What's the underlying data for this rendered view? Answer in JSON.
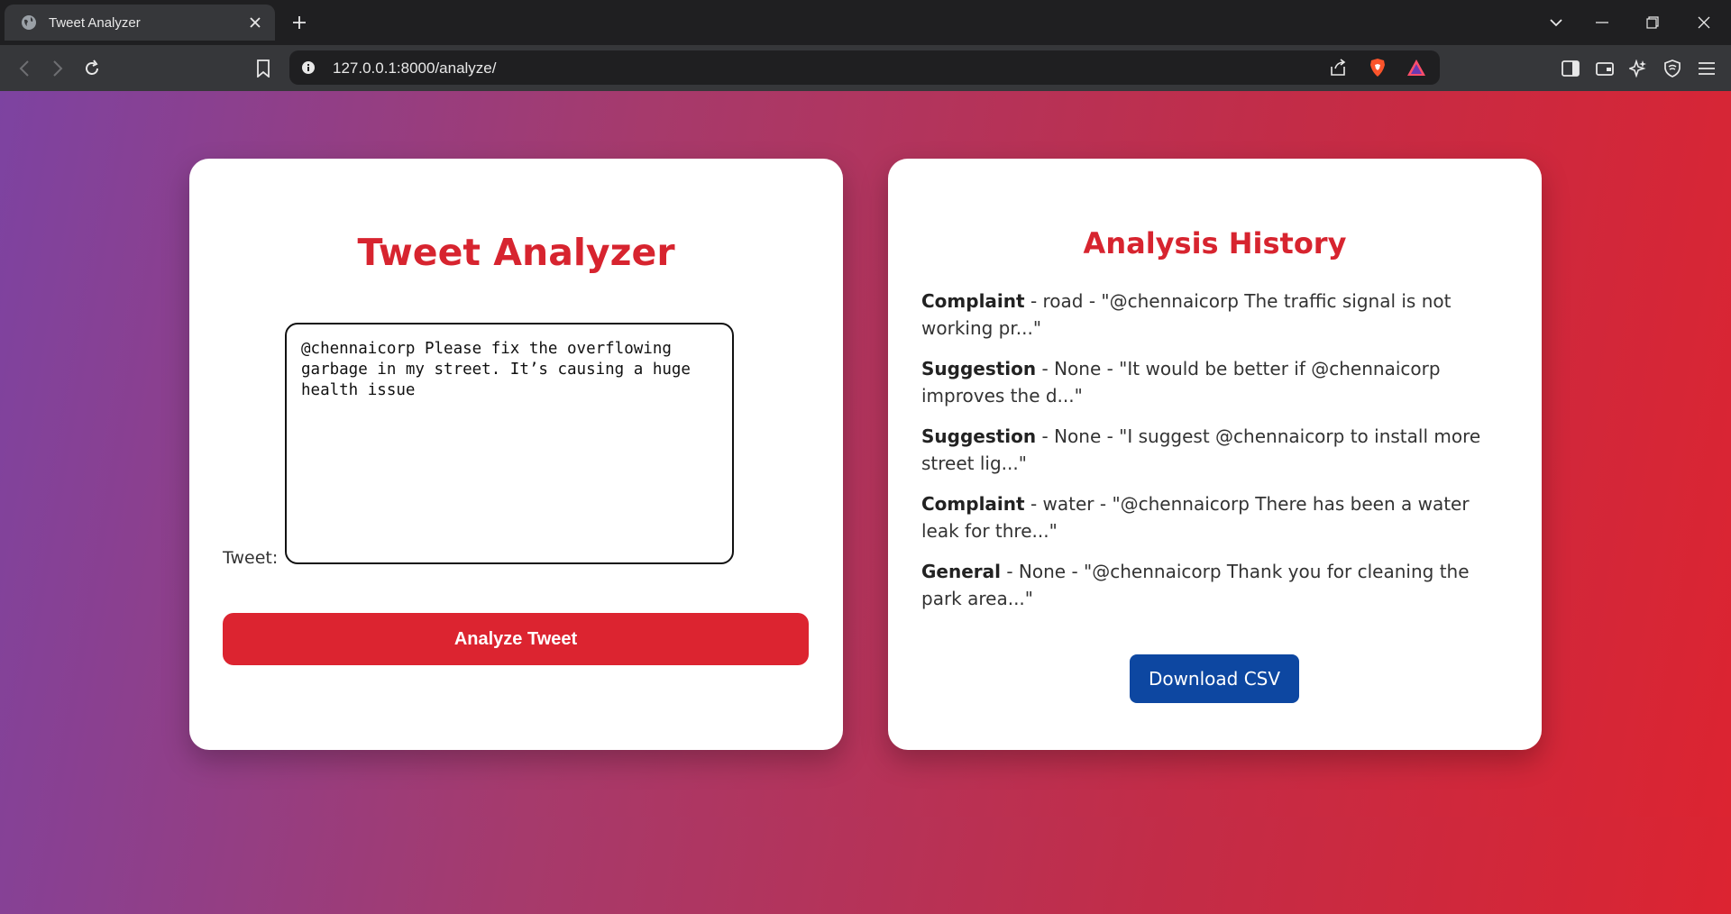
{
  "browser": {
    "tab_title": "Tweet Analyzer",
    "url": "127.0.0.1:8000/analyze/"
  },
  "analyzer": {
    "title": "Tweet Analyzer",
    "tweet_label": "Tweet:",
    "tweet_value": "@chennaicorp Please fix the overflowing garbage in my street. It’s causing a huge health issue",
    "analyze_button": "Analyze Tweet"
  },
  "history": {
    "title": "Analysis History",
    "items": [
      {
        "category": "Complaint",
        "rest": " - road - \"@chennaicorp The traffic signal is not working pr...\""
      },
      {
        "category": "Suggestion",
        "rest": " - None - \"It would be better if @chennaicorp improves the d...\""
      },
      {
        "category": "Suggestion",
        "rest": " - None - \"I suggest @chennaicorp to install more street lig...\""
      },
      {
        "category": "Complaint",
        "rest": " - water - \"@chennaicorp There has been a water leak for thre...\""
      },
      {
        "category": "General",
        "rest": " - None - \"@chennaicorp Thank you for cleaning the park area...\""
      }
    ],
    "download_button": "Download CSV"
  },
  "colors": {
    "accent_red": "#dc2430",
    "title_red": "#d7242f",
    "download_blue": "#0d47a1"
  }
}
